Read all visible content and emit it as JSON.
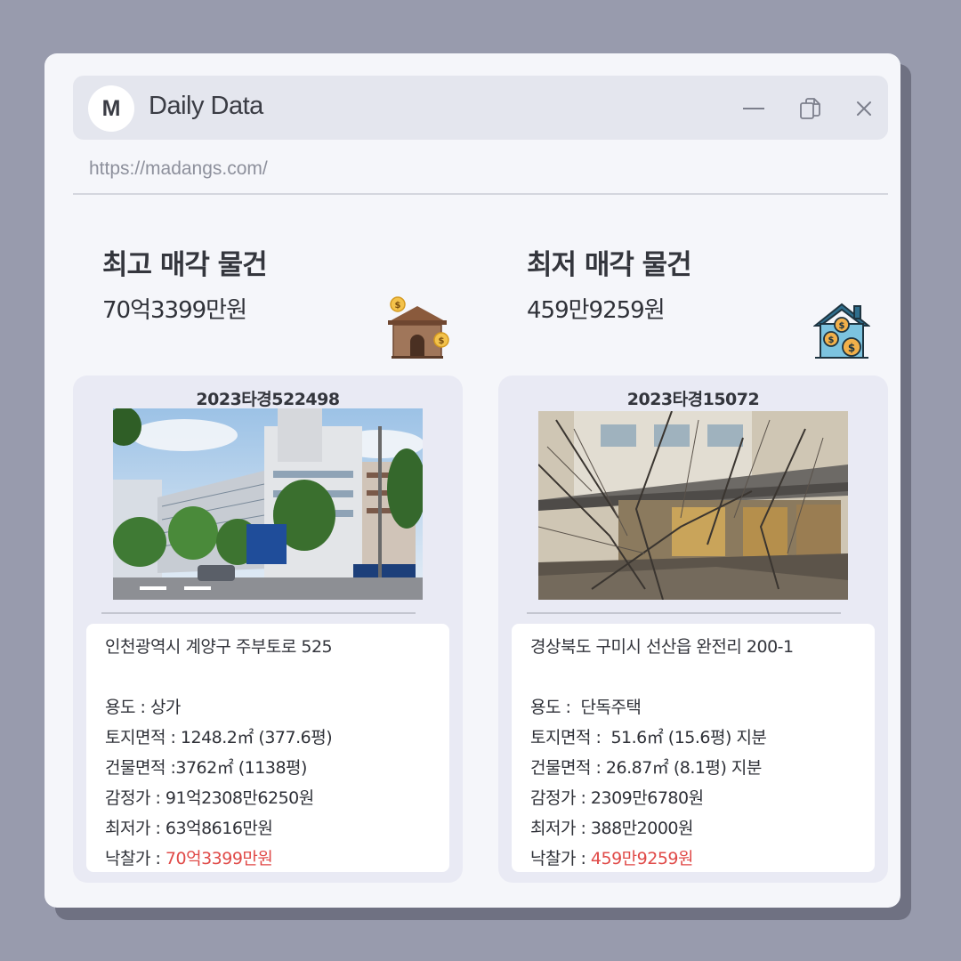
{
  "app": {
    "avatar_letter": "M",
    "title": "Daily Data",
    "url": "https://madangs.com/"
  },
  "colors": {
    "background": "#989bad",
    "window": "#f5f6fa",
    "card": "#e9eaf4",
    "highlight": "#e04a48"
  },
  "icons": {
    "minimize": "minimize-icon",
    "copy": "copy-icon",
    "close": "close-icon",
    "house_money_brown": "house-money-icon",
    "house_money_blue": "house-coins-icon"
  },
  "highest": {
    "heading": "최고 매각 물건",
    "amount": "70억3399만원",
    "case_no": "2023타경522498",
    "address": "인천광역시 계양구 주부토로 525",
    "rows": [
      {
        "label": "용도 : ",
        "value": "상가"
      },
      {
        "label": "토지면적 : ",
        "value": "1248.2㎡ (377.6평)"
      },
      {
        "label": "건물면적 :",
        "value": "3762㎡ (1138평)"
      },
      {
        "label": "감정가 : ",
        "value": "91억2308만6250원"
      },
      {
        "label": "최저가 : ",
        "value": "63억8616만원"
      }
    ],
    "winning_label": "낙찰가 : ",
    "winning_value": "70억3399만원"
  },
  "lowest": {
    "heading": "최저 매각 물건",
    "amount": "459만9259원",
    "case_no": "2023타경15072",
    "address": "경상북도 구미시 선산읍 완전리 200-1",
    "rows": [
      {
        "label": "용도 :  ",
        "value": "단독주택"
      },
      {
        "label": "토지면적 :  ",
        "value": "51.6㎡ (15.6평) 지분"
      },
      {
        "label": "건물면적 : ",
        "value": "26.87㎡ (8.1평) 지분"
      },
      {
        "label": "감정가 : ",
        "value": "2309만6780원"
      },
      {
        "label": "최저가 : ",
        "value": "388만2000원"
      }
    ],
    "winning_label": "낙찰가 : ",
    "winning_value": "459만9259원"
  }
}
